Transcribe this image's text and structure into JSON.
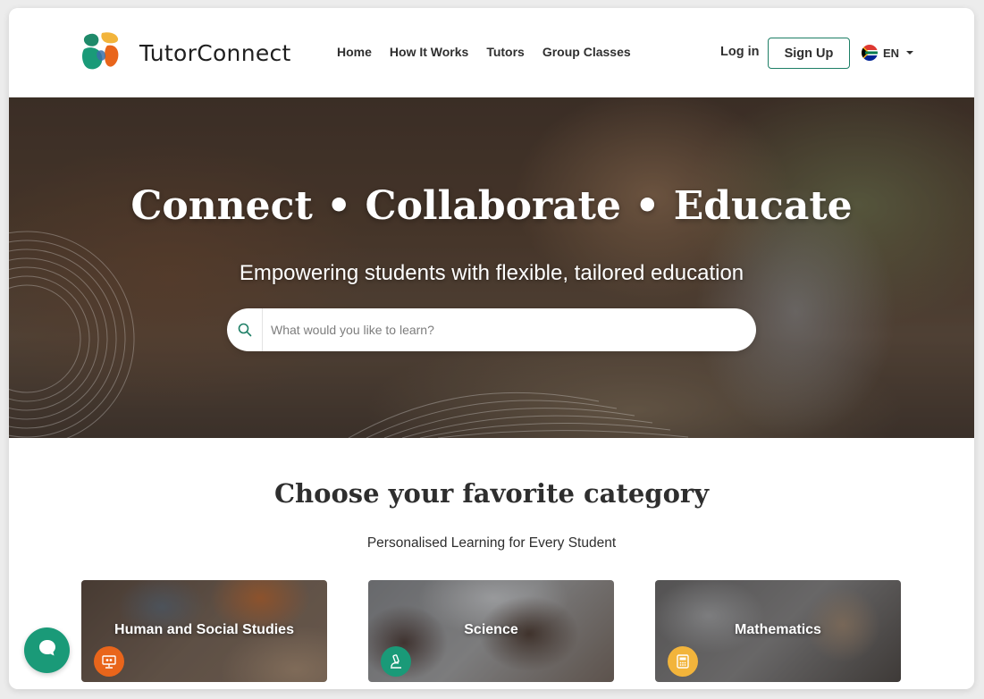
{
  "header": {
    "logo_text": "TutorConnect",
    "nav": [
      {
        "label": "Home"
      },
      {
        "label": "How It Works"
      },
      {
        "label": "Tutors"
      },
      {
        "label": "Group Classes"
      }
    ],
    "login_label": "Log in",
    "signup_label": "Sign Up",
    "language": "EN"
  },
  "hero": {
    "title": "Connect • Collaborate • Educate",
    "subtitle": "Empowering students with flexible, tailored education",
    "search_placeholder": "What would you like to learn?"
  },
  "categories": {
    "title": "Choose your favorite category",
    "subtitle": "Personalised Learning for Every Student",
    "items": [
      {
        "label": "Human and Social Studies",
        "icon": "presentation-icon",
        "badge_color": "#e9651b"
      },
      {
        "label": "Science",
        "icon": "microscope-icon",
        "badge_color": "#1a9a78"
      },
      {
        "label": "Mathematics",
        "icon": "calculator-icon",
        "badge_color": "#f2b43b"
      }
    ]
  },
  "colors": {
    "accent_green": "#1a9a78",
    "signup_border": "#1e7f66",
    "text_dark": "#2e2e2e"
  },
  "chat": {
    "icon": "chat-bubble-icon"
  }
}
